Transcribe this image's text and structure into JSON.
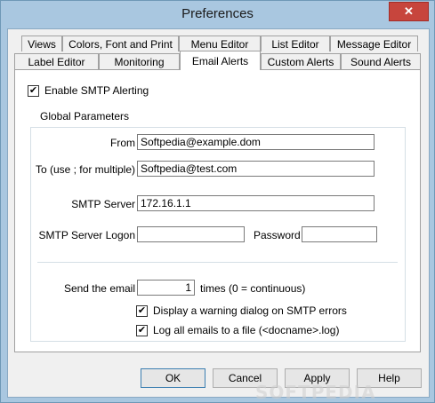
{
  "window": {
    "title": "Preferences",
    "close_glyph": "✕"
  },
  "tabs_row1": [
    "Views",
    "Colors, Font and Print",
    "Menu Editor",
    "List Editor",
    "Message Editor"
  ],
  "tabs_row2": [
    "Label Editor",
    "Monitoring",
    "Email Alerts",
    "Custom Alerts",
    "Sound Alerts"
  ],
  "active_tab": "Email Alerts",
  "enable_smtp": {
    "label": "Enable SMTP Alerting",
    "checked": true
  },
  "group": {
    "title": "Global Parameters",
    "from_label": "From",
    "from_value": "Softpedia@example.dom",
    "to_label": "To (use ; for multiple)",
    "to_value": "Softpedia@test.com",
    "server_label": "SMTP Server",
    "server_value": "172.16.1.1",
    "logon_label": "SMTP Server Logon",
    "logon_value": "",
    "password_label": "Password",
    "password_value": ""
  },
  "send": {
    "label": "Send the email",
    "value": "1",
    "suffix": "times (0 = continuous)"
  },
  "warn_dialog": {
    "label": "Display a warning dialog on SMTP errors",
    "checked": true
  },
  "log_file": {
    "label": "Log all emails to a file (<docname>.log)",
    "checked": true
  },
  "buttons": {
    "ok": "OK",
    "cancel": "Cancel",
    "apply": "Apply",
    "help": "Help"
  },
  "watermark": "SOFTPEDIA",
  "colors": {
    "title_bar": "#a9c7e0",
    "close_button": "#c7453d",
    "dialog_bg": "#f0f0f0"
  }
}
